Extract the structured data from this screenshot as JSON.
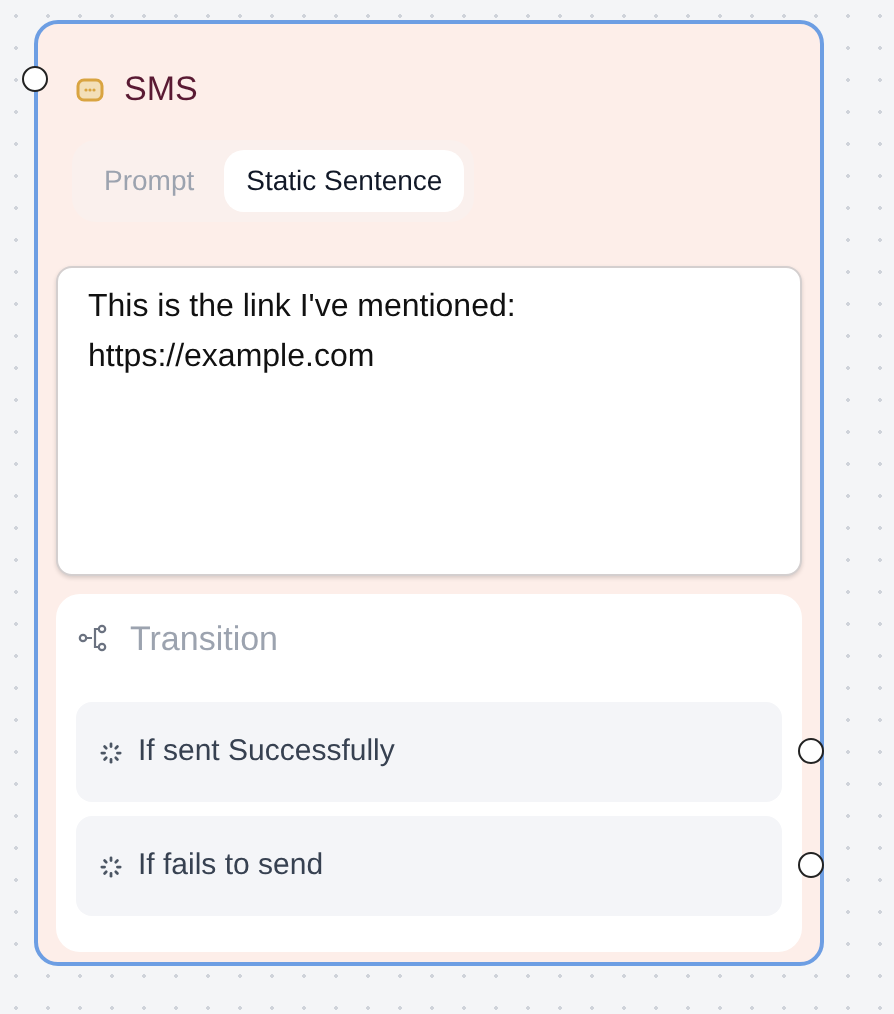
{
  "node": {
    "title": "SMS",
    "tabs": [
      {
        "label": "Prompt",
        "selected": false
      },
      {
        "label": "Static Sentence",
        "selected": true
      }
    ],
    "message": {
      "value": "This is the link I've mentioned: https://example.com"
    },
    "transition": {
      "title": "Transition",
      "items": [
        {
          "label": "If sent Successfully"
        },
        {
          "label": "If fails to send"
        }
      ]
    }
  }
}
